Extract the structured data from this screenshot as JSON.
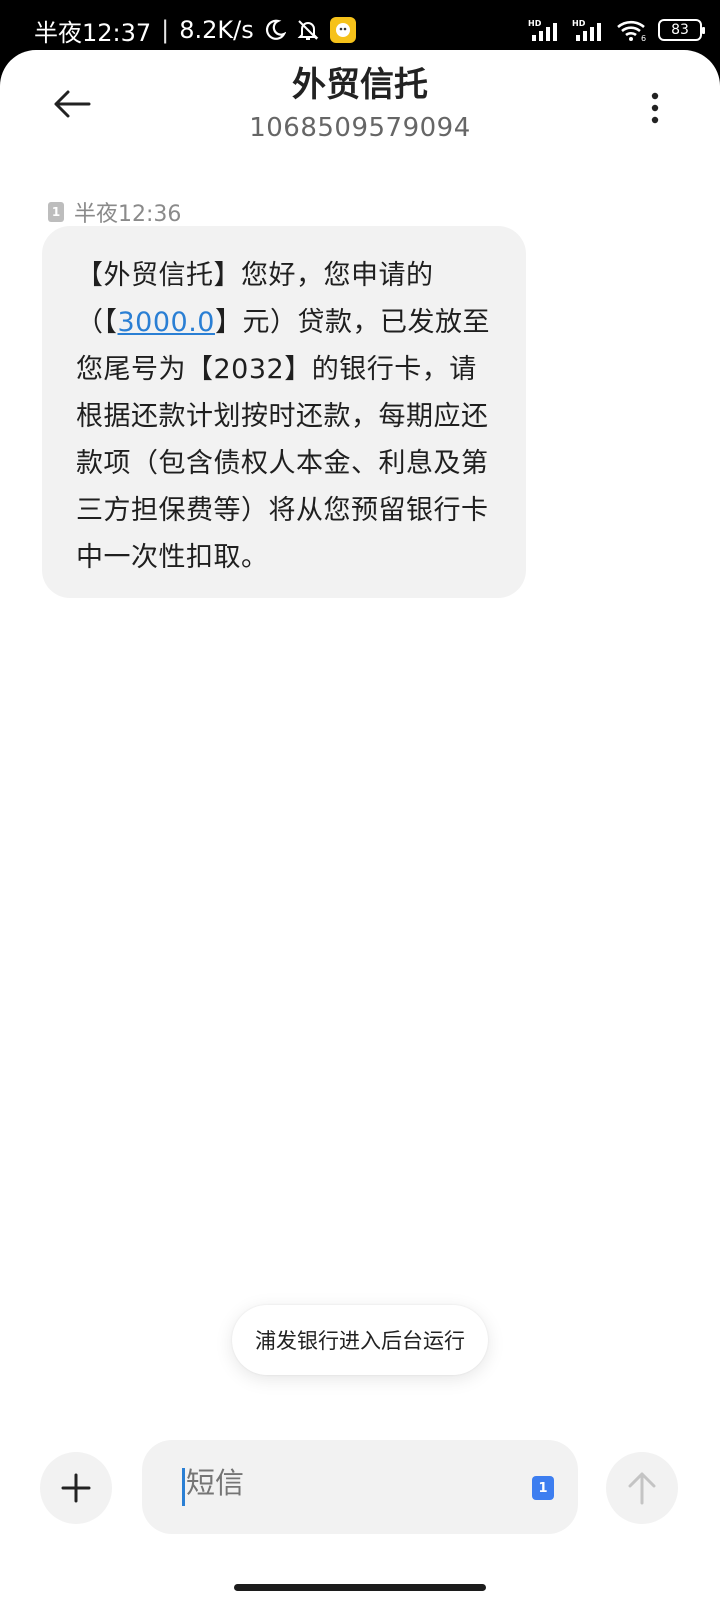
{
  "status_bar": {
    "time": "半夜12:37",
    "net_speed": "8.2K/s",
    "battery": "83",
    "hd1": "HD",
    "hd2": "HD",
    "wifi_sub": "6",
    "icons": [
      "moon-icon",
      "mute-bell-icon",
      "app-notification-icon",
      "signal-icon",
      "wifi-icon",
      "battery-icon"
    ]
  },
  "header": {
    "title": "外贸信托",
    "number": "1068509579094"
  },
  "message": {
    "sim": "1",
    "timestamp": "半夜12:36",
    "text_before_link": "【外贸信托】您好，您申请的（【",
    "link_text": "3000.0",
    "text_after_link": "】元）贷款，已发放至您尾号为【2032】的银行卡，请根据还款计划按时还款，每期应还款项（包含债权人本金、利息及第三方担保费等）将从您预留银行卡中一次性扣取。"
  },
  "toast": {
    "text": "浦发银行进入后台运行"
  },
  "composer": {
    "placeholder": "短信",
    "sim": "1"
  },
  "colors": {
    "link": "#2a7fd4",
    "bubble": "#f2f2f2",
    "sim_badge": "#3d7ef0"
  }
}
